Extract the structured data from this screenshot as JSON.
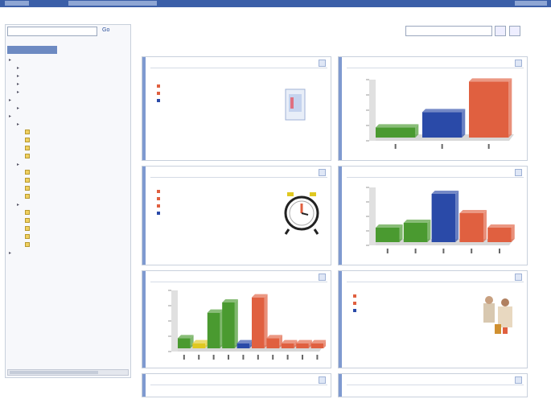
{
  "app": {
    "title": ""
  },
  "left": {
    "dropdown": "",
    "go": "Go",
    "links": [
      "",
      ""
    ],
    "tree": [
      {
        "label": "",
        "indent": 0,
        "icon": false
      },
      {
        "label": "",
        "indent": 1,
        "icon": false
      },
      {
        "label": "",
        "indent": 1,
        "icon": false
      },
      {
        "label": "",
        "indent": 1,
        "icon": false
      },
      {
        "label": "",
        "indent": 1,
        "icon": false
      },
      {
        "label": "",
        "indent": 0,
        "icon": false
      },
      {
        "label": "",
        "indent": 1,
        "icon": false
      },
      {
        "label": "",
        "indent": 0,
        "icon": false
      },
      {
        "label": "",
        "indent": 1,
        "icon": false
      },
      {
        "label": "",
        "indent": 2,
        "icon": true
      },
      {
        "label": "",
        "indent": 2,
        "icon": true
      },
      {
        "label": "",
        "indent": 2,
        "icon": true
      },
      {
        "label": "",
        "indent": 2,
        "icon": true
      },
      {
        "label": "",
        "indent": 1,
        "icon": false
      },
      {
        "label": "",
        "indent": 2,
        "icon": true
      },
      {
        "label": "",
        "indent": 2,
        "icon": true
      },
      {
        "label": "",
        "indent": 2,
        "icon": true
      },
      {
        "label": "",
        "indent": 2,
        "icon": true
      },
      {
        "label": "",
        "indent": 1,
        "icon": false
      },
      {
        "label": "",
        "indent": 2,
        "icon": true
      },
      {
        "label": "",
        "indent": 2,
        "icon": true
      },
      {
        "label": "",
        "indent": 2,
        "icon": true
      },
      {
        "label": "",
        "indent": 2,
        "icon": true
      },
      {
        "label": "",
        "indent": 2,
        "icon": true
      },
      {
        "label": "",
        "indent": 0,
        "icon": false
      }
    ]
  },
  "header": {
    "title": "",
    "sub": "",
    "right": "",
    "view_label": "",
    "view_value": ""
  },
  "colors": {
    "red": "#e06040",
    "blue": "#2a4aa8",
    "green": "#4a9a30",
    "yellow": "#e0c820",
    "accent": "#7f9ad0"
  },
  "portlets": {
    "p1": {
      "title": "",
      "link": "",
      "legend": [
        {
          "name": "",
          "num": "",
          "color": "#e06040"
        },
        {
          "name": "",
          "num": "",
          "color": "#e06040"
        },
        {
          "name": "",
          "num": "",
          "color": "#2a4aa8"
        }
      ],
      "view": ""
    },
    "p2": {
      "title": "",
      "link": "",
      "legend": [
        {
          "name": "",
          "num": "",
          "color": "#e06040"
        },
        {
          "name": "",
          "num": "",
          "color": "#e06040"
        },
        {
          "name": "",
          "num": "",
          "color": "#e06040"
        },
        {
          "name": "",
          "num": "",
          "color": "#2a4aa8"
        }
      ],
      "view": ""
    },
    "p3": {
      "title": "",
      "link": ""
    },
    "p4": {
      "title": "",
      "link": ""
    },
    "p5": {
      "title": "",
      "link": ""
    },
    "p6": {
      "title": "",
      "link": "",
      "legend": [
        {
          "name": "",
          "num": "",
          "color": "#e06040"
        },
        {
          "name": "",
          "num": "",
          "color": "#e06040"
        },
        {
          "name": "",
          "num": "",
          "color": "#2a4aa8"
        }
      ],
      "view": ""
    },
    "p7": {
      "title": "",
      "link": ""
    },
    "p8": {
      "title": "",
      "link": ""
    }
  },
  "chart_data": [
    {
      "type": "bar",
      "categories": [
        "",
        "",
        ""
      ],
      "values": [
        2,
        5,
        11
      ],
      "colors": [
        "#4a9a30",
        "#2a4aa8",
        "#e06040"
      ],
      "ylim": [
        0,
        12
      ]
    },
    {
      "type": "bar",
      "categories": [
        "",
        "",
        "",
        "",
        ""
      ],
      "values": [
        3,
        4,
        10,
        6,
        3
      ],
      "colors": [
        "#4a9a30",
        "#4a9a30",
        "#2a4aa8",
        "#e06040",
        "#e06040"
      ],
      "ylim": [
        0,
        12
      ]
    },
    {
      "type": "bar",
      "categories": [
        "",
        "",
        "",
        "",
        "",
        "",
        "",
        "",
        "",
        ""
      ],
      "values": [
        2,
        1,
        7,
        9,
        1,
        10,
        2,
        1,
        1,
        1
      ],
      "colors": [
        "#4a9a30",
        "#e0c820",
        "#4a9a30",
        "#4a9a30",
        "#2a4aa8",
        "#e06040",
        "#e06040",
        "#e06040",
        "#e06040",
        "#e06040"
      ],
      "ylim": [
        0,
        12
      ]
    }
  ]
}
